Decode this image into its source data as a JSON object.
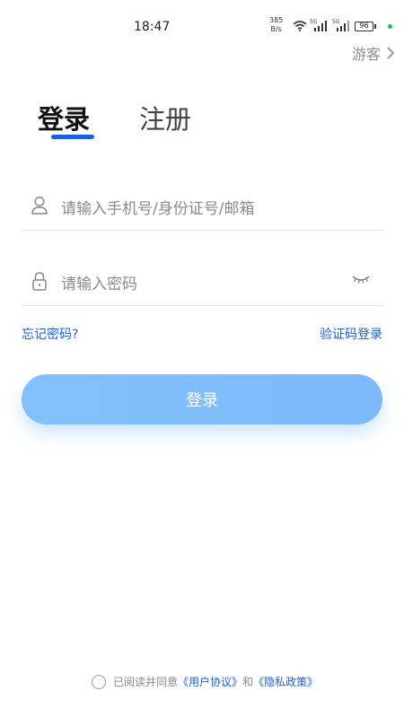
{
  "status_bar": {
    "time": "18:47",
    "net_speed_value": "385",
    "net_speed_unit": "B/s",
    "network_1": "5G",
    "network_2": "5G",
    "battery": "96",
    "indicator_color": "#1fbf55"
  },
  "header": {
    "guest_label": "游客"
  },
  "tabs": {
    "login": "登录",
    "register": "注册"
  },
  "form": {
    "phone_placeholder": "请输入手机号/身份证号/邮箱",
    "password_placeholder": "请输入密码",
    "forgot_password": "忘记密码?",
    "sms_login": "验证码登录",
    "login_button": "登录"
  },
  "agreement": {
    "prefix": "已阅读并同意",
    "user_agreement": "《用户协议》",
    "and": "和",
    "privacy_policy": "《隐私政策》"
  },
  "colors": {
    "accent": "#1a5fe0",
    "button": "#7cb9fb"
  }
}
